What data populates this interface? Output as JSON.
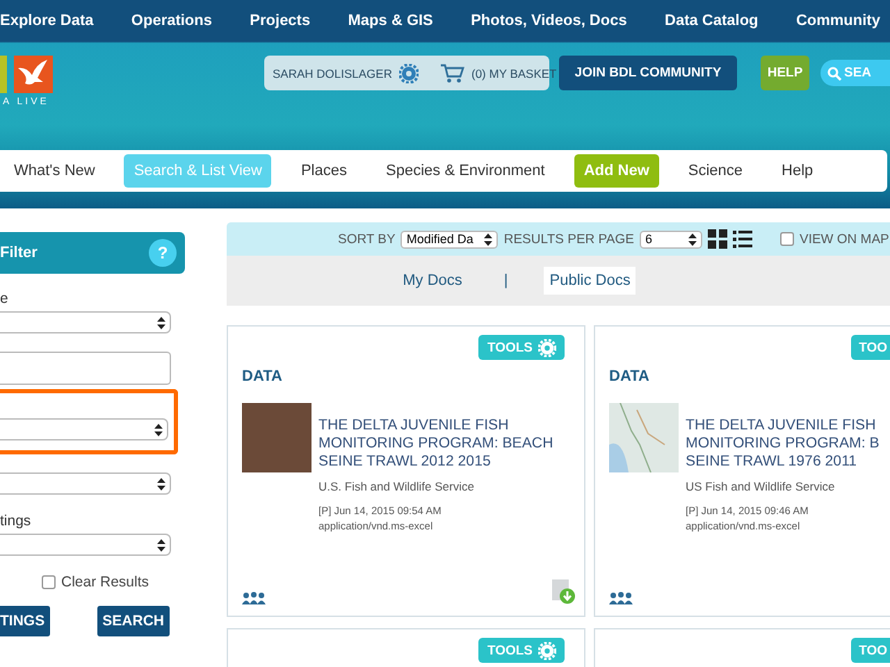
{
  "top_nav": [
    "Explore Data",
    "Operations",
    "Projects",
    "Maps & GIS",
    "Photos, Videos, Docs",
    "Data Catalog",
    "Community"
  ],
  "logo": {
    "text": "A LIVE"
  },
  "user": {
    "name": "SARAH DOLISLAGER",
    "basket": "(0) MY BASKET"
  },
  "header_buttons": [
    {
      "label": "JOIN BDL COMMUNITY",
      "kind": "join"
    },
    {
      "label": "HELP",
      "kind": "help"
    },
    {
      "label": "SEA",
      "kind": "search"
    }
  ],
  "sub_nav": [
    {
      "label": "What's New",
      "selected": false,
      "kind": "link"
    },
    {
      "label": "Search & List View",
      "selected": true,
      "kind": "link"
    },
    {
      "label": "Places",
      "selected": false,
      "kind": "link"
    },
    {
      "label": "Species & Environment",
      "selected": false,
      "kind": "link"
    },
    {
      "label": "Add New",
      "selected": false,
      "kind": "action"
    },
    {
      "label": "Science",
      "selected": false,
      "kind": "link"
    },
    {
      "label": "Help",
      "selected": false,
      "kind": "link"
    }
  ],
  "filter": {
    "title": "Filter",
    "help": "?",
    "fields": [
      {
        "kind": "select",
        "label": "e",
        "highlighted": false
      },
      {
        "kind": "input",
        "highlighted": false
      },
      {
        "kind": "select",
        "highlighted": true
      },
      {
        "kind": "select",
        "highlighted": false
      },
      {
        "kind": "select",
        "label": "tings",
        "highlighted": false
      }
    ],
    "clear_results": {
      "label": "Clear Results",
      "checked": false
    },
    "buttons": [
      "TINGS",
      "SEARCH"
    ]
  },
  "toolbar": {
    "sort_label": "SORT BY",
    "sort_value": "Modified Da",
    "per_page_label": "RESULTS PER PAGE",
    "per_page_value": "6",
    "view_on_map": {
      "label": "VIEW ON MAP",
      "checked": false
    }
  },
  "doc_tabs": [
    {
      "label": "My Docs",
      "selected": false
    },
    {
      "label": "Public Docs",
      "selected": true
    }
  ],
  "doc_tabs_separator": "|",
  "cards": [
    {
      "tools": "TOOLS",
      "gear": true,
      "category": "DATA",
      "kind": "photo",
      "title_lines": [
        "THE DELTA JUVENILE FISH",
        "MONITORING PROGRAM: BEACH",
        "SEINE TRAWL 2012 2015"
      ],
      "publisher": "U.S. Fish and Wildlife Service",
      "date": "[P] Jun 14, 2015 09:54 AM",
      "mime": "application/vnd.ms-excel",
      "download": true
    },
    {
      "tools": "TOO",
      "gear": false,
      "category": "DATA",
      "kind": "map",
      "title_lines": [
        "THE DELTA JUVENILE FISH",
        "MONITORING PROGRAM: B",
        "SEINE TRAWL 1976 2011"
      ],
      "publisher": "US Fish and Wildlife Service",
      "date": "[P] Jun 14, 2015 09:46 AM",
      "mime": "application/vnd.ms-excel",
      "download": false
    },
    {
      "tools": "TOOLS",
      "gear": true,
      "kind": "stub"
    },
    {
      "tools": "TOO",
      "gear": false,
      "kind": "stub"
    }
  ]
}
